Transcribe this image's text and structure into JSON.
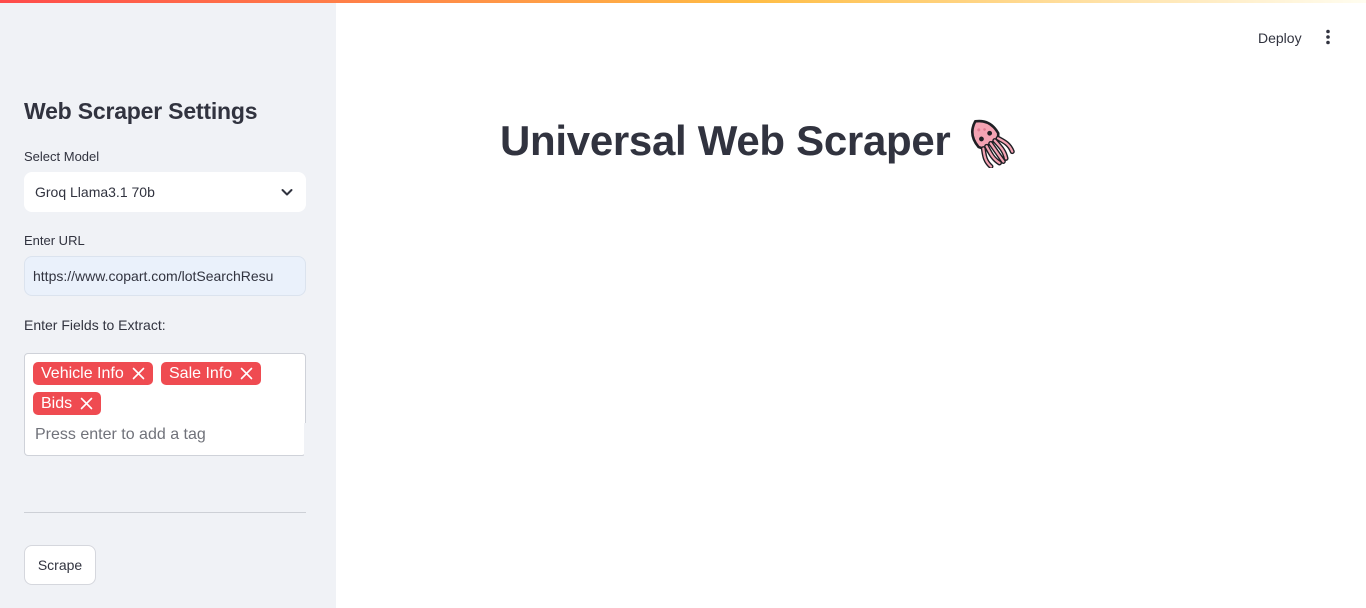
{
  "header": {
    "deploy_label": "Deploy",
    "menu_icon": "more-vertical-icon"
  },
  "sidebar": {
    "title": "Web Scraper Settings",
    "model": {
      "label": "Select Model",
      "selected": "Groq Llama3.1 70b",
      "icon": "chevron-down-icon"
    },
    "url": {
      "label": "Enter URL",
      "value": "https://www.copart.com/lotSearchResu"
    },
    "fields": {
      "label": "Enter Fields to Extract:",
      "tags": [
        "Vehicle Info",
        "Sale Info",
        "Bids"
      ],
      "placeholder": "Press enter to add a tag"
    },
    "scrape_label": "Scrape"
  },
  "main": {
    "title": "Universal Web Scraper",
    "title_icon": "squid-icon"
  },
  "colors": {
    "sidebar_bg": "#f0f2f6",
    "tag_bg": "#ef4b51",
    "text": "#31333f"
  }
}
